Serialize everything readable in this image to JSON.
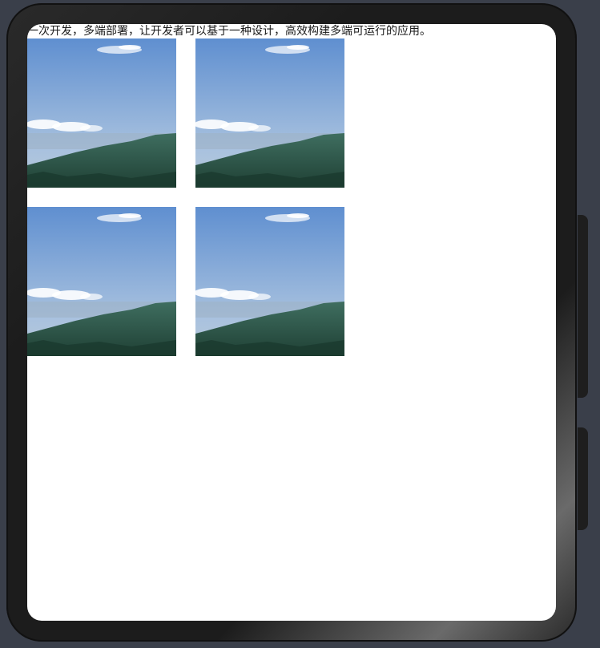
{
  "screen": {
    "caption": "一次开发，多端部署，让开发者可以基于一种设计，高效构建多端可运行的应用。"
  },
  "gallery": {
    "images": [
      {
        "subject": "mountain-landscape-photo"
      },
      {
        "subject": "mountain-landscape-photo"
      },
      {
        "subject": "mountain-landscape-photo"
      },
      {
        "subject": "mountain-landscape-photo"
      }
    ]
  },
  "colors": {
    "frame": "#1c1c1c",
    "screen_bg": "#ffffff",
    "sky_top": "#5f8fd0",
    "sky_bottom": "#a9c2df",
    "mountain": "#2e5a4a"
  }
}
